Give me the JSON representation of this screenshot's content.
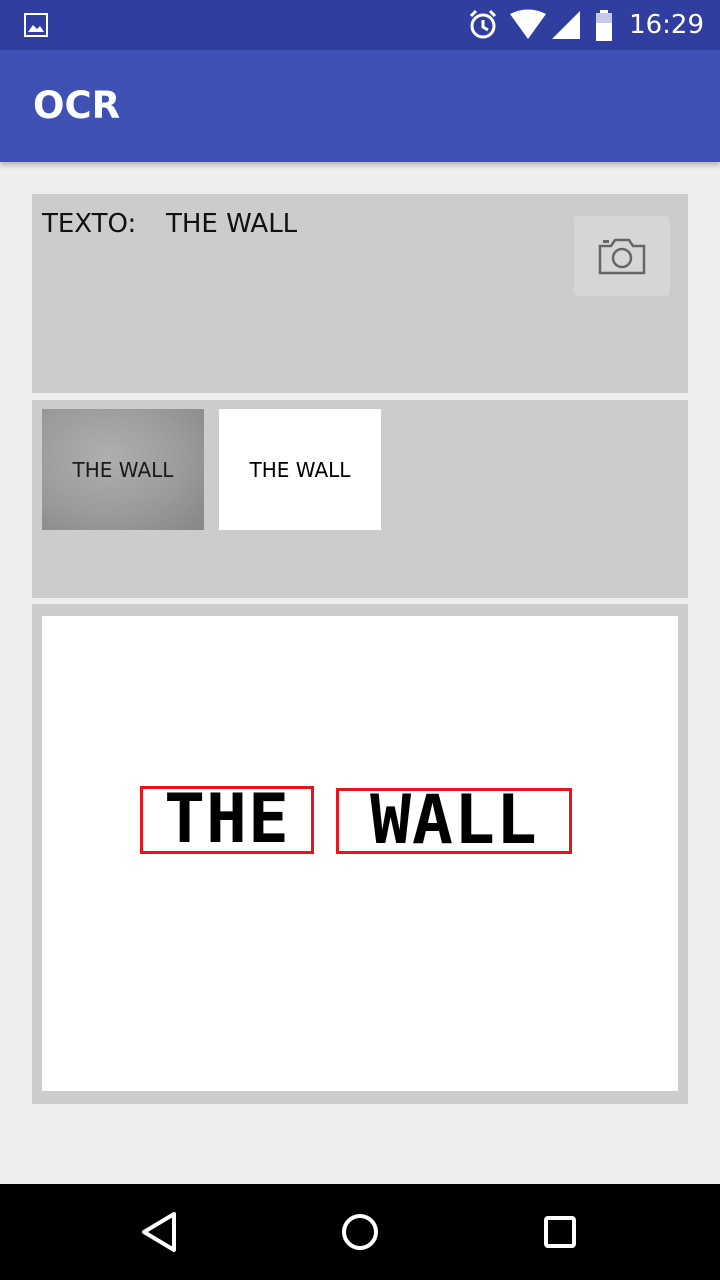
{
  "status_bar": {
    "time": "16:29",
    "icons": [
      "gallery-icon",
      "alarm-icon",
      "wifi-icon",
      "signal-icon",
      "battery-icon"
    ]
  },
  "app_bar": {
    "title": "OCR"
  },
  "ocr_result": {
    "label": "TEXTO:",
    "value": "THE WALL",
    "camera_icon": "camera-icon"
  },
  "thumbnails": {
    "original_text": "THE WALL",
    "processed_text": "THE WALL"
  },
  "detection": {
    "words": [
      "THE",
      "WALL"
    ],
    "box_color": "#e8141c"
  },
  "nav_bar": {
    "icons": [
      "back-icon",
      "home-icon",
      "recents-icon"
    ]
  },
  "colors": {
    "primary": "#3f51b5",
    "primary_dark": "#303f9f",
    "panel": "#cccccc",
    "background": "#eeeeee"
  }
}
